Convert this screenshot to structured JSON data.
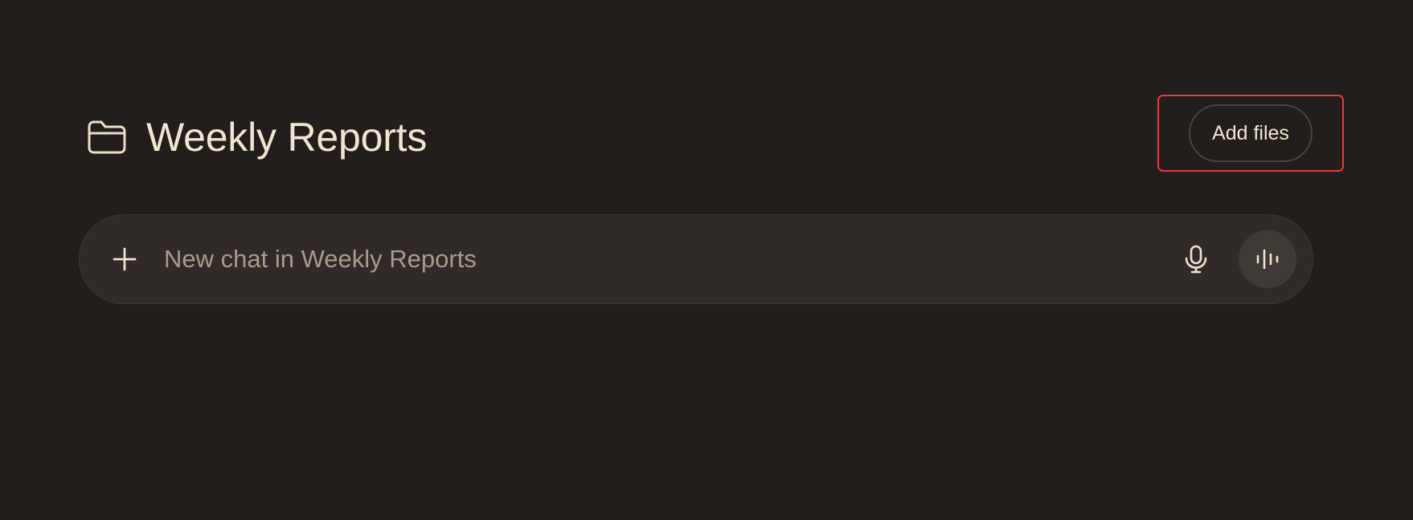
{
  "project": {
    "title": "Weekly Reports",
    "folder_icon": "folder-icon"
  },
  "actions": {
    "add_files_label": "Add files"
  },
  "chat": {
    "placeholder": "New chat in Weekly Reports",
    "value": "",
    "plus_icon": "plus-icon",
    "mic_icon": "microphone-icon",
    "voice_icon": "voice-waveform-icon"
  },
  "colors": {
    "background": "#221e1b",
    "text": "#f2e5d0",
    "placeholder": "#a89b8a",
    "chat_bar": "#302b28",
    "voice_button": "#403a36",
    "highlight": "#e43b3b"
  }
}
